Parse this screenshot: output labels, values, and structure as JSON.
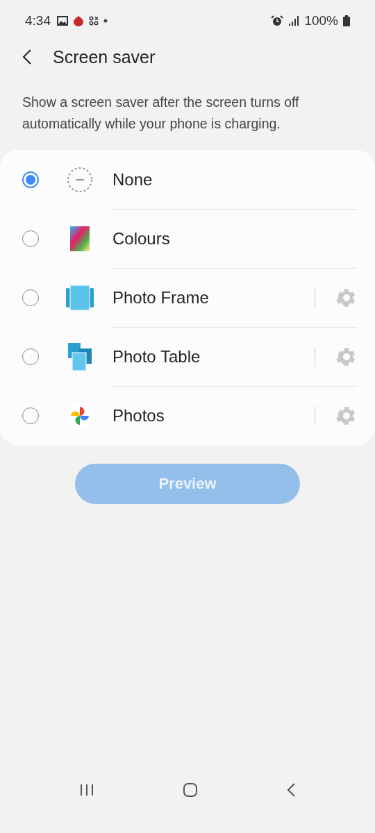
{
  "status_bar": {
    "time": "4:34",
    "battery": "100%"
  },
  "header": {
    "title": "Screen saver"
  },
  "description": "Show a screen saver after the screen turns off automatically while your phone is charging.",
  "options": [
    {
      "label": "None",
      "kind": "none",
      "selected": true,
      "settings": false
    },
    {
      "label": "Colours",
      "kind": "colours",
      "selected": false,
      "settings": false
    },
    {
      "label": "Photo Frame",
      "kind": "frame",
      "selected": false,
      "settings": true
    },
    {
      "label": "Photo Table",
      "kind": "table",
      "selected": false,
      "settings": true
    },
    {
      "label": "Photos",
      "kind": "photos",
      "selected": false,
      "settings": true
    }
  ],
  "preview_button": {
    "label": "Preview",
    "disabled": true
  }
}
